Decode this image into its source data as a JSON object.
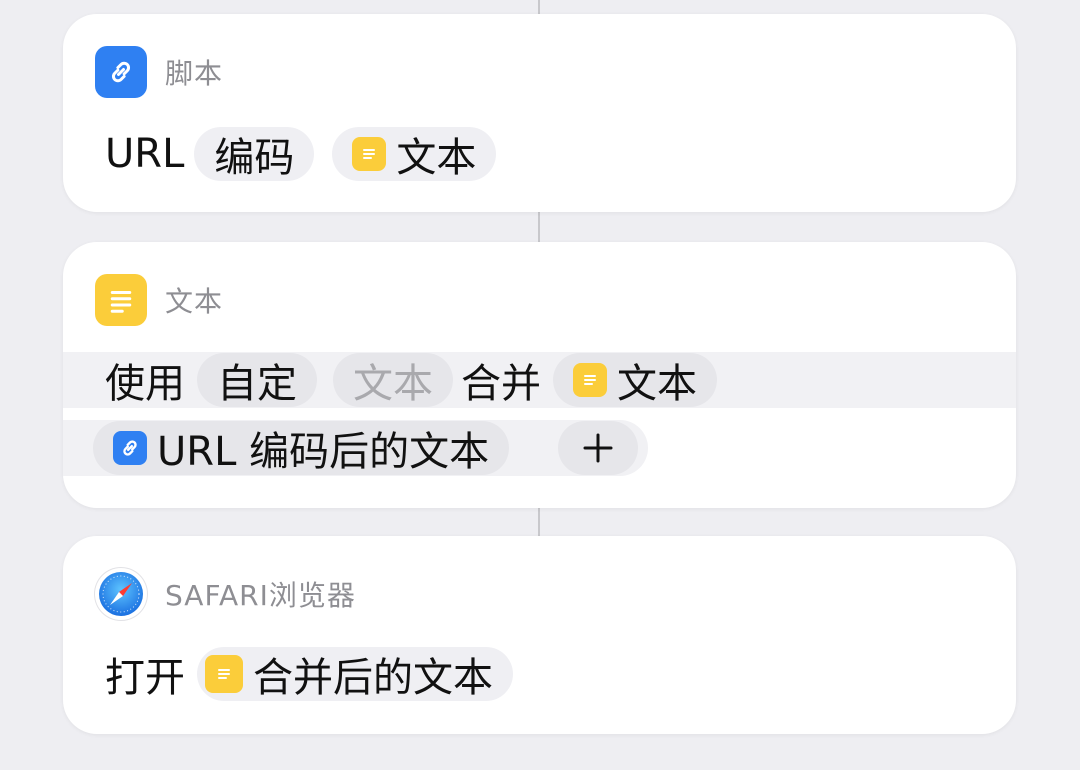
{
  "colors": {
    "background": "#eeeef2",
    "card": "#ffffff",
    "header_text": "#8e8e93",
    "blue_icon": "#2f80f2",
    "yellow_icon": "#fbcd3a",
    "token_bg": "#efeff3",
    "placeholder": "#a9a9ad"
  },
  "actions": [
    {
      "app": "脚本",
      "icon": "link-icon",
      "line": {
        "verb": "URL",
        "mode": "编码",
        "input_label": "文本",
        "input_icon": "text-doc-icon"
      }
    },
    {
      "app": "文本",
      "icon": "text-lines-icon",
      "line1": {
        "verb": "使用",
        "separator_choice": "自定",
        "separator_placeholder": "文本",
        "join_word": "合并",
        "input_label": "文本",
        "input_icon": "text-doc-icon"
      },
      "line2": {
        "variable_label": "URL 编码后的文本",
        "variable_icon": "link-icon",
        "add_symbol": "+"
      }
    },
    {
      "app": "SAFARI浏览器",
      "icon": "safari-compass-icon",
      "line": {
        "verb": "打开",
        "input_label": "合并后的文本",
        "input_icon": "text-doc-icon"
      }
    }
  ]
}
